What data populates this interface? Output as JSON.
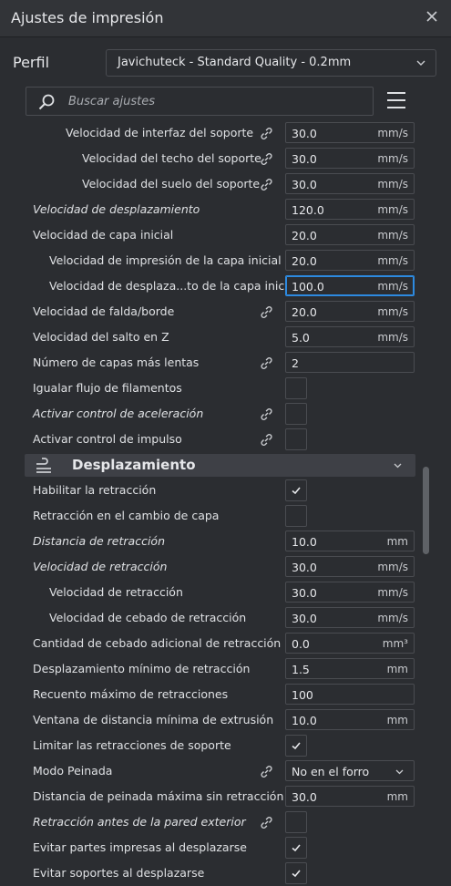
{
  "window": {
    "title": "Ajustes de impresión"
  },
  "profile": {
    "label": "Perfil",
    "value": "Javichuteck - Standard Quality - 0.2mm"
  },
  "search": {
    "placeholder": "Buscar ajustes"
  },
  "section": {
    "title": "Desplazamiento"
  },
  "rows": [
    {
      "label": "Velocidad de interfaz del soporte",
      "indent": 2,
      "italic": false,
      "link": true,
      "kind": "field",
      "value": "30.0",
      "unit": "mm/s"
    },
    {
      "label": "Velocidad del techo del soporte",
      "indent": 3,
      "italic": false,
      "link": true,
      "kind": "field",
      "value": "30.0",
      "unit": "mm/s"
    },
    {
      "label": "Velocidad del suelo del soporte",
      "indent": 3,
      "italic": false,
      "link": true,
      "kind": "field",
      "value": "30.0",
      "unit": "mm/s"
    },
    {
      "label": "Velocidad de desplazamiento",
      "indent": 0,
      "italic": true,
      "link": false,
      "kind": "field",
      "value": "120.0",
      "unit": "mm/s"
    },
    {
      "label": "Velocidad de capa inicial",
      "indent": 0,
      "italic": false,
      "link": false,
      "kind": "field",
      "value": "20.0",
      "unit": "mm/s"
    },
    {
      "label": "Velocidad de impresión de la capa inicial",
      "indent": 1,
      "italic": false,
      "link": false,
      "kind": "field",
      "value": "20.0",
      "unit": "mm/s"
    },
    {
      "label": "Velocidad de desplaza...to de la capa inicial",
      "indent": 1,
      "italic": false,
      "link": false,
      "kind": "field",
      "value": "100.0",
      "unit": "mm/s",
      "focused": true
    },
    {
      "label": "Velocidad de falda/borde",
      "indent": 0,
      "italic": false,
      "link": true,
      "kind": "field",
      "value": "20.0",
      "unit": "mm/s"
    },
    {
      "label": "Velocidad del salto en Z",
      "indent": 0,
      "italic": false,
      "link": false,
      "kind": "field",
      "value": "5.0",
      "unit": "mm/s"
    },
    {
      "label": "Número de capas más lentas",
      "indent": 0,
      "italic": false,
      "link": true,
      "kind": "field",
      "value": "2",
      "unit": ""
    },
    {
      "label": "Igualar flujo de filamentos",
      "indent": 0,
      "italic": false,
      "link": false,
      "kind": "check",
      "checked": false
    },
    {
      "label": "Activar control de aceleración",
      "indent": 0,
      "italic": true,
      "link": true,
      "kind": "check",
      "checked": false
    },
    {
      "label": "Activar control de impulso",
      "indent": 0,
      "italic": false,
      "link": true,
      "kind": "check",
      "checked": false
    },
    {
      "kind": "section"
    },
    {
      "label": "Habilitar la retracción",
      "indent": 0,
      "italic": false,
      "link": false,
      "kind": "check",
      "checked": true
    },
    {
      "label": "Retracción en el cambio de capa",
      "indent": 0,
      "italic": false,
      "link": false,
      "kind": "check",
      "checked": false
    },
    {
      "label": "Distancia de retracción",
      "indent": 0,
      "italic": true,
      "link": false,
      "kind": "field",
      "value": "10.0",
      "unit": "mm"
    },
    {
      "label": "Velocidad de retracción",
      "indent": 0,
      "italic": true,
      "link": false,
      "kind": "field",
      "value": "30.0",
      "unit": "mm/s"
    },
    {
      "label": "Velocidad de retracción",
      "indent": 1,
      "italic": false,
      "link": false,
      "kind": "field",
      "value": "30.0",
      "unit": "mm/s"
    },
    {
      "label": "Velocidad de cebado de retracción",
      "indent": 1,
      "italic": false,
      "link": false,
      "kind": "field",
      "value": "30.0",
      "unit": "mm/s"
    },
    {
      "label": "Cantidad de cebado adicional de retracción",
      "indent": 0,
      "italic": false,
      "link": false,
      "kind": "field",
      "value": "0.0",
      "unit": "mm³"
    },
    {
      "label": "Desplazamiento mínimo de retracción",
      "indent": 0,
      "italic": false,
      "link": false,
      "kind": "field",
      "value": "1.5",
      "unit": "mm"
    },
    {
      "label": "Recuento máximo de retracciones",
      "indent": 0,
      "italic": false,
      "link": false,
      "kind": "field",
      "value": "100",
      "unit": ""
    },
    {
      "label": "Ventana de distancia mínima de extrusión",
      "indent": 0,
      "italic": false,
      "link": false,
      "kind": "field",
      "value": "10.0",
      "unit": "mm"
    },
    {
      "label": "Limitar las retracciones de soporte",
      "indent": 0,
      "italic": false,
      "link": false,
      "kind": "check",
      "checked": true
    },
    {
      "label": "Modo Peinada",
      "indent": 0,
      "italic": false,
      "link": true,
      "kind": "select",
      "value": "No en el forro"
    },
    {
      "label": "Distancia de peinada máxima sin retracción",
      "indent": 0,
      "italic": false,
      "link": false,
      "kind": "field",
      "value": "30.0",
      "unit": "mm"
    },
    {
      "label": "Retracción antes de la pared exterior",
      "indent": 0,
      "italic": true,
      "link": true,
      "kind": "check",
      "checked": false
    },
    {
      "label": "Evitar partes impresas al desplazarse",
      "indent": 0,
      "italic": false,
      "link": false,
      "kind": "check",
      "checked": true
    },
    {
      "label": "Evitar soportes al desplazarse",
      "indent": 0,
      "italic": false,
      "link": false,
      "kind": "check",
      "checked": true
    }
  ]
}
